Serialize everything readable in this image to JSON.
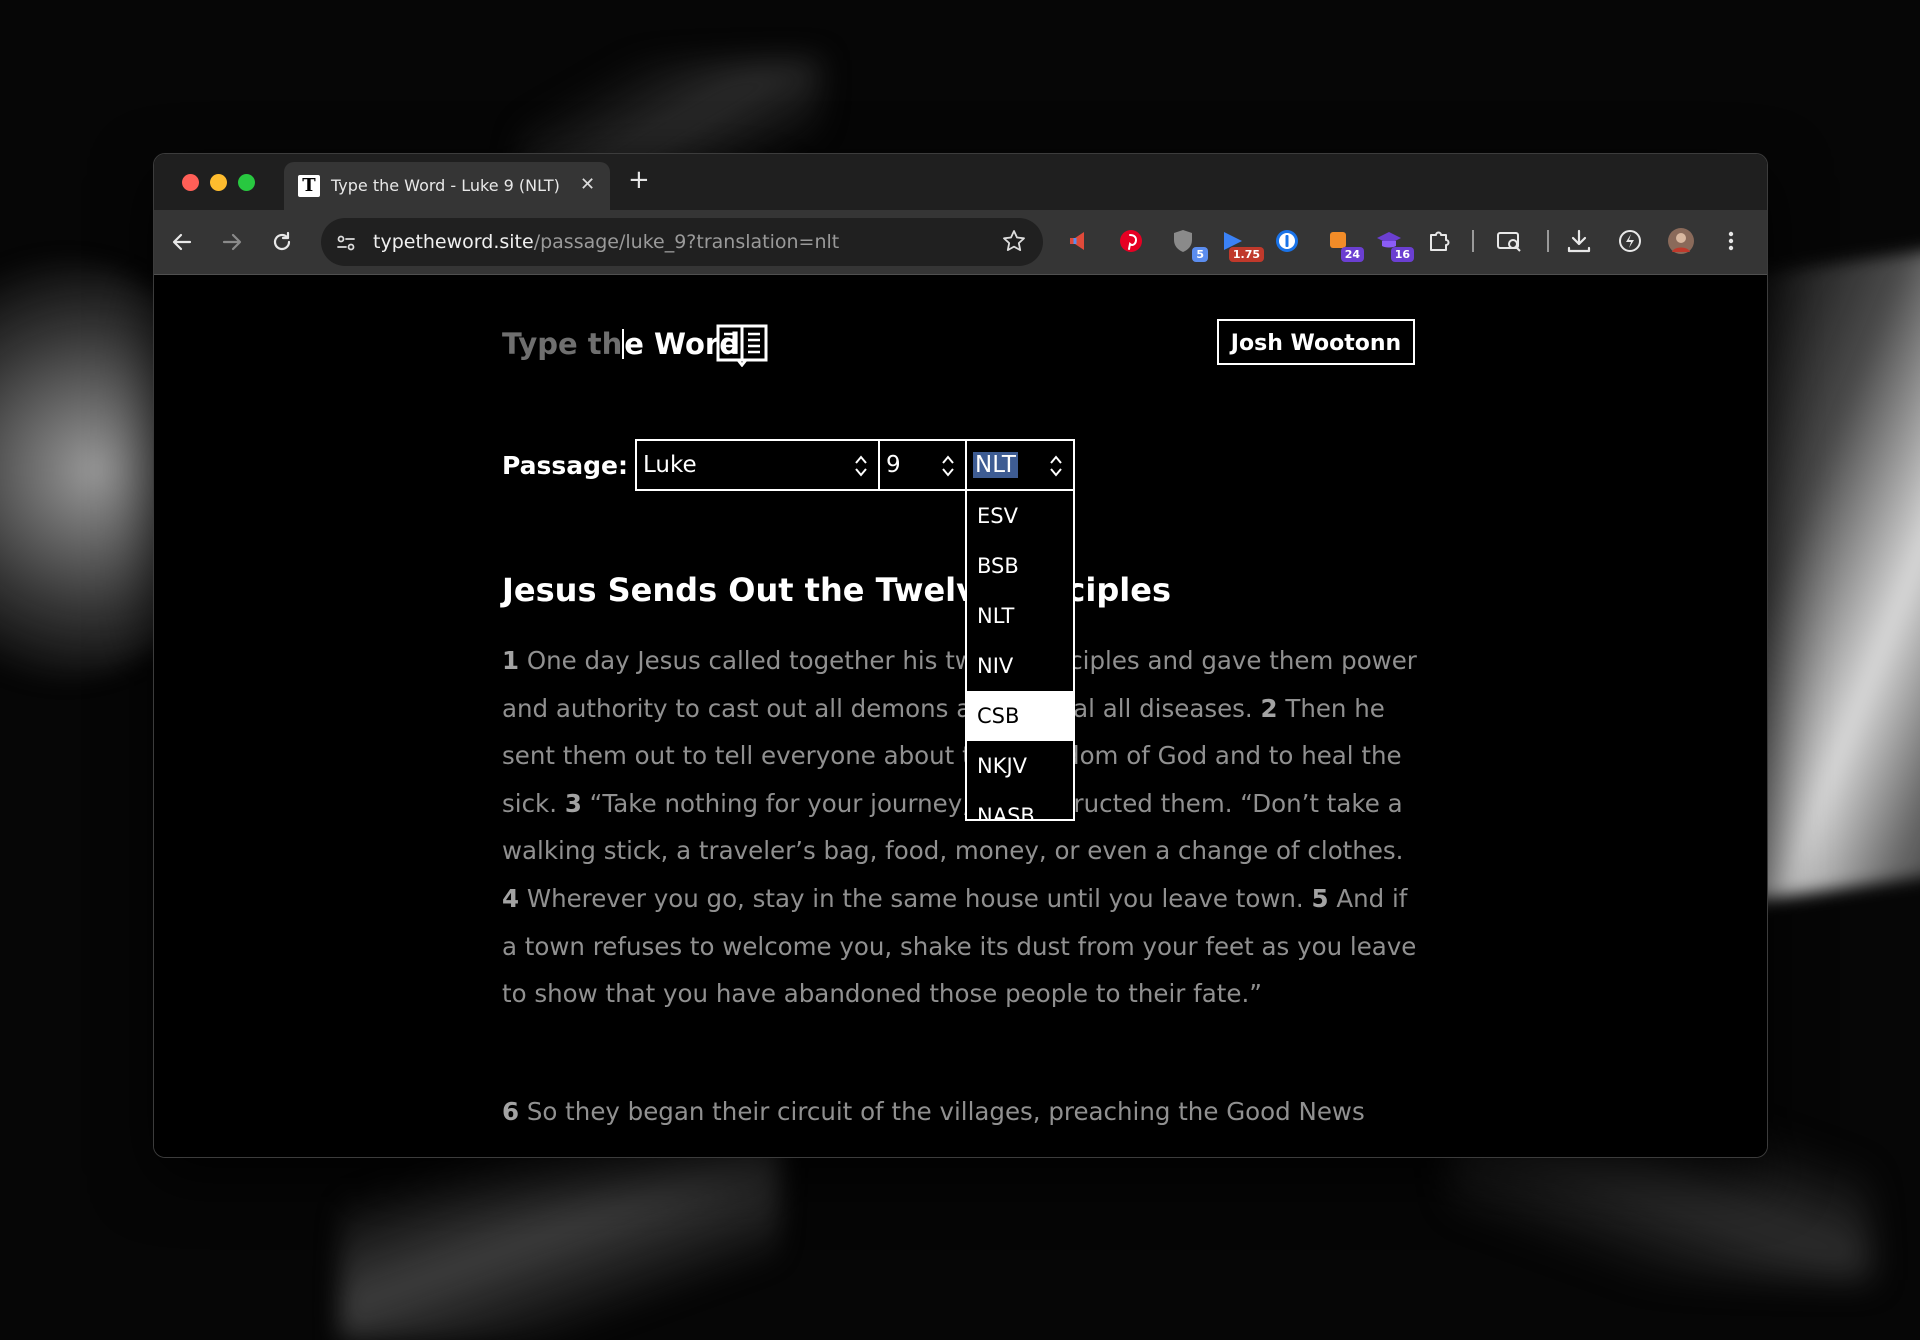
{
  "browser": {
    "tab": {
      "title": "Type the Word - Luke 9 (NLT)",
      "favicon": "T"
    },
    "url": {
      "host": "typetheword.site",
      "path": "/passage/luke_9?translation=nlt"
    },
    "extensions": [
      {
        "icon": "megaphone-icon",
        "badge": ""
      },
      {
        "icon": "pinterest-icon",
        "badge": ""
      },
      {
        "icon": "shield-icon",
        "badge": "5",
        "badge_color": "#5b8def"
      },
      {
        "icon": "media-icon",
        "badge": "1.75",
        "badge_color": "#c0392b"
      },
      {
        "icon": "1password-icon",
        "badge": ""
      },
      {
        "icon": "ext-orange-icon",
        "badge": "24",
        "badge_color": "#6b3fd1"
      },
      {
        "icon": "graduation-cap-icon",
        "badge": "16",
        "badge_color": "#6b3fd1"
      },
      {
        "icon": "puzzle-icon",
        "badge": ""
      }
    ]
  },
  "page": {
    "logo": {
      "dim": "Type th",
      "lit": "e Word"
    },
    "user_name": "Josh Wootonn",
    "passage_label": "Passage:",
    "book": "Luke",
    "chapter": "9",
    "translation": "NLT",
    "translation_options": [
      "ESV",
      "BSB",
      "NLT",
      "NIV",
      "CSB",
      "NKJV",
      "NASB"
    ],
    "highlighted_option": "CSB",
    "heading": "Jesus Sends Out the Twelve Disciples",
    "verses": [
      {
        "n": "1",
        "text": " One day Jesus called together his twelve disciples   and gave them power and authority to cast out all demons and to heal all diseases. "
      },
      {
        "n": "2",
        "text": " Then he sent them out to tell everyone about the Kingdom of God and to heal the sick. "
      },
      {
        "n": "3",
        "text": " “Take nothing for your journey,” he instructed them. “Don’t take a walking stick, a traveler’s bag, food, money,   or even a change of clothes.   "
      },
      {
        "n": "4",
        "text": " Wherever you go, stay in the same house until you leave town.   "
      },
      {
        "n": "5",
        "text": " And if a town refuses to welcome you, shake its dust from your feet as you leave to show that you have abandoned those people to their fate.”"
      }
    ],
    "verse6": {
      "n": "6",
      "text": " So they began their circuit of the villages, preaching the Good News"
    }
  }
}
